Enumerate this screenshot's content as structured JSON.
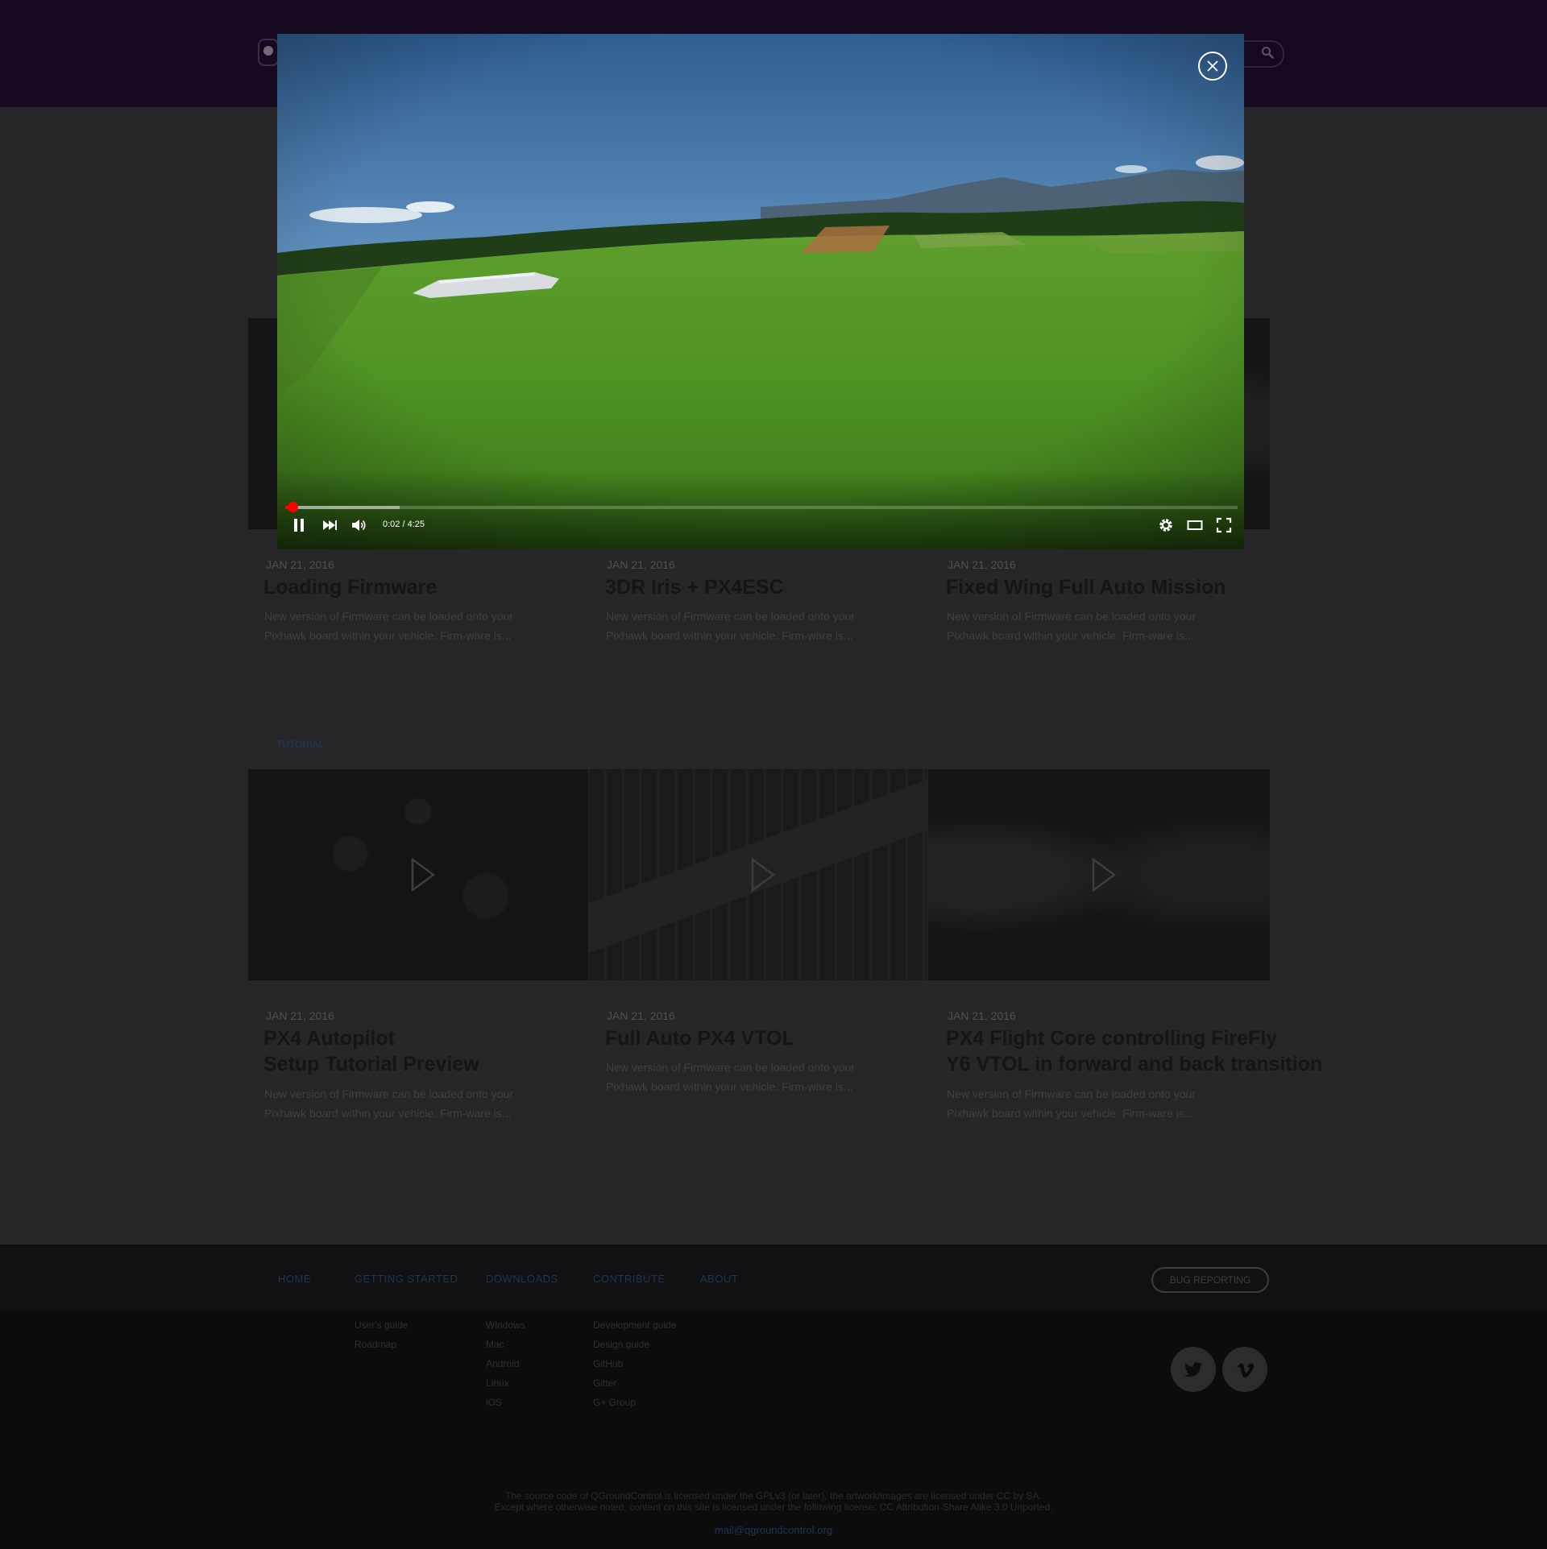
{
  "header": {
    "logo": "qgroundcontrol-logo-icon",
    "search_icon": "search-icon"
  },
  "sections": [
    {
      "label": "",
      "cards": [
        {
          "date": "JAN 21, 2016",
          "title": "Loading Firmware",
          "desc": "New version of Firmware can be loaded onto your Pixhawk board within your vehicle. Firm-ware is..."
        },
        {
          "date": "JAN 21, 2016",
          "title": "3DR Iris + PX4ESC",
          "desc": "New version of Firmware can be loaded onto your Pixhawk board within your vehicle. Firm-ware is..."
        },
        {
          "date": "JAN 21, 2016",
          "title": "Fixed Wing Full Auto Mission",
          "desc": "New version of Firmware can be loaded onto your Pixhawk board within your vehicle. Firm-ware is..."
        }
      ]
    },
    {
      "label": "TUTORIAL",
      "cards": [
        {
          "date": "JAN 21, 2016",
          "title": "PX4 Autopilot",
          "title2": "Setup Tutorial Preview",
          "desc": "New version of Firmware can be loaded onto your Pixhawk board within your vehicle. Firm-ware is..."
        },
        {
          "date": "JAN 21, 2016",
          "title": "Full Auto PX4 VTOL",
          "desc": "New version of Firmware can be loaded onto your Pixhawk board within your vehicle. Firm-ware is..."
        },
        {
          "date": "JAN 21, 2016",
          "title": "PX4 Flight Core controlling FireFly",
          "title2": "Y6 VTOL in forward and back transition",
          "desc": "New version of Firmware can be loaded onto your Pixhawk board within your vehicle. Firm-ware is..."
        }
      ]
    }
  ],
  "footer": {
    "nav": [
      "HOME",
      "GETTING STARTED",
      "DOWNLOADS",
      "CONTRIBUTE",
      "ABOUT"
    ],
    "bug_button": "BUG REPORTING",
    "getting_started_links": [
      "User's guide",
      "Roadmap"
    ],
    "downloads_links": [
      "Windows",
      "Mac",
      "Android",
      "Linux",
      "iOS"
    ],
    "contribute_links": [
      "Development guide",
      "Design guide",
      "GitHub",
      "Gitter",
      "G+ Group"
    ],
    "social_icons": [
      "twitter-icon",
      "vimeo-icon"
    ],
    "legal_line1": "The source code of QGroundControl is licensed under the GPLv3 (or later), the artwork/images are licensed under CC by SA.",
    "legal_line2": "Except where otherwise noted, content on this site is licensed under the following license: CC Attribution-Share Alike 3.0 Unported.",
    "email": "mail@qgroundcontrol.org"
  },
  "video_player": {
    "time": "0:02 / 4:25",
    "progress_played_fraction": 0.008,
    "progress_buffered_fraction": 0.12,
    "icons": [
      "pause-icon",
      "next-icon",
      "volume-icon",
      "settings-icon",
      "theater-mode-icon",
      "fullscreen-icon",
      "close-icon"
    ]
  },
  "colors": {
    "header_bg": "#14091f",
    "link_blue": "#1d3655",
    "progress_red": "#ff0000"
  }
}
